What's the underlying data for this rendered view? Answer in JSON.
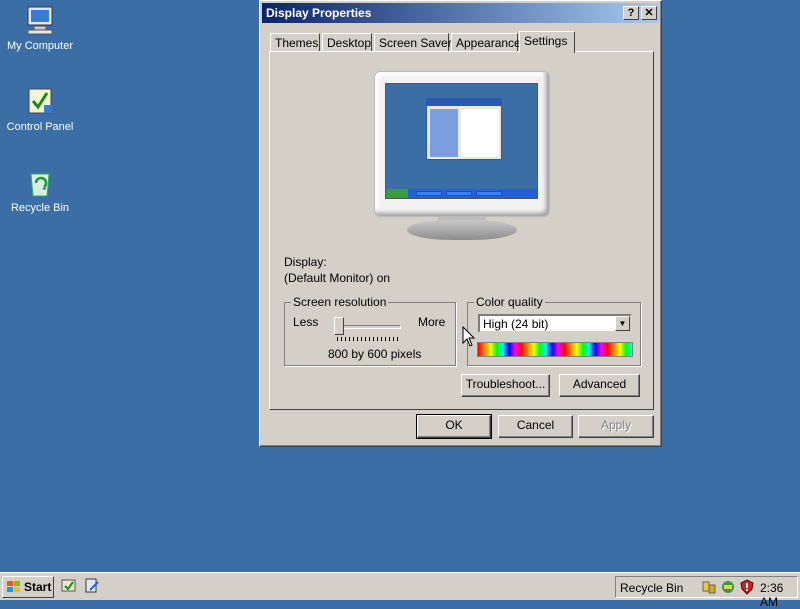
{
  "desktop": {
    "icons": [
      {
        "label": "My Computer",
        "icon": "my-computer-icon"
      },
      {
        "label": "Control Panel",
        "icon": "control-panel-icon"
      },
      {
        "label": "Recycle Bin",
        "icon": "recycle-bin-icon"
      }
    ]
  },
  "window": {
    "title": "Display Properties",
    "help_button": "?",
    "close_button": "✕",
    "tabs": [
      {
        "label": "Themes"
      },
      {
        "label": "Desktop"
      },
      {
        "label": "Screen Saver"
      },
      {
        "label": "Appearance"
      },
      {
        "label": "Settings",
        "active": true
      }
    ],
    "display_label": "Display:",
    "display_value": "(Default Monitor) on",
    "resolution": {
      "legend": "Screen resolution",
      "less_label": "Less",
      "more_label": "More",
      "value_text": "800 by 600 pixels",
      "slider_level": 0
    },
    "color_quality": {
      "legend": "Color quality",
      "selected": "High (24 bit)"
    },
    "buttons": {
      "troubleshoot": "Troubleshoot...",
      "advanced": "Advanced",
      "ok": "OK",
      "cancel": "Cancel",
      "apply": "Apply"
    }
  },
  "taskbar": {
    "start_label": "Start",
    "quick_launch": [
      "show-desktop-icon",
      "internet-explorer-icon"
    ],
    "tray_label": "Recycle Bin",
    "tray_icons": [
      "network-icon",
      "security-center-icon",
      "shield-alert-icon"
    ],
    "clock": "2:36 AM"
  },
  "colors": {
    "desktop_bg": "#3a6ea5",
    "window_face": "#d4d0c8",
    "title_start": "#0a246a",
    "title_end": "#a6caf0"
  }
}
